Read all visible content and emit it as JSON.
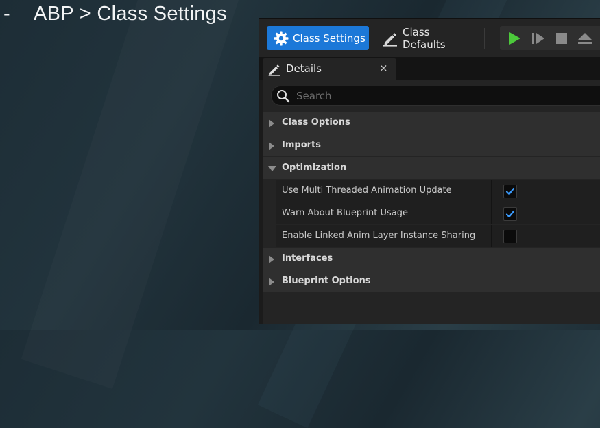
{
  "caption": {
    "dash": "-",
    "text": "ABP > Class Settings"
  },
  "toolbar": {
    "class_settings_label": "Class Settings",
    "class_defaults_label": "Class Defaults",
    "active_button_color": "#1c78d8",
    "play_color": "#4cc93b"
  },
  "tab": {
    "label": "Details",
    "close": "×"
  },
  "search": {
    "placeholder": "Search",
    "value": ""
  },
  "categories": {
    "class_options": "Class Options",
    "imports": "Imports",
    "optimization": "Optimization",
    "interfaces": "Interfaces",
    "blueprint_options": "Blueprint Options"
  },
  "properties": [
    {
      "label": "Use Multi Threaded Animation Update",
      "checked": true
    },
    {
      "label": "Warn About Blueprint Usage",
      "checked": true
    },
    {
      "label": "Enable Linked Anim Layer Instance Sharing",
      "checked": false
    }
  ]
}
